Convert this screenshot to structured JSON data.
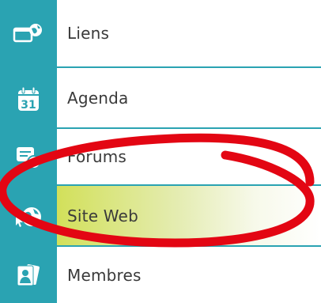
{
  "menu": {
    "items": [
      {
        "label": "Liens",
        "icon": "window-globe-icon",
        "active": false
      },
      {
        "label": "Agenda",
        "icon": "calendar-31-icon",
        "active": false
      },
      {
        "label": "Forums",
        "icon": "forum-chat-icon",
        "active": false
      },
      {
        "label": "Site Web",
        "icon": "globe-cursor-icon",
        "active": true
      },
      {
        "label": "Membres",
        "icon": "member-cards-icon",
        "active": false
      }
    ],
    "agenda_day": "31"
  },
  "colors": {
    "rail": "#2aa3b2",
    "active_highlight": "#d2e05a",
    "annotation": "#e30613",
    "text": "#3a3a3a"
  }
}
